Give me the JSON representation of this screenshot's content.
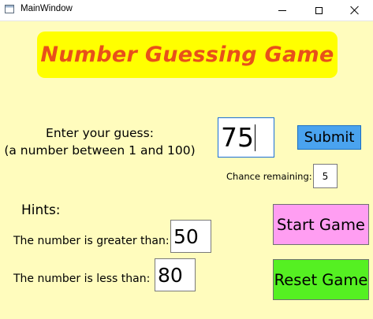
{
  "window": {
    "title": "MainWindow"
  },
  "banner": {
    "title": "Number Guessing Game"
  },
  "guess": {
    "prompt_line1": "Enter your guess:",
    "prompt_line2": "(a number between 1 and 100)",
    "value": "75",
    "submit_label": "Submit"
  },
  "chances": {
    "label": "Chance remaining:",
    "value": "5"
  },
  "hints": {
    "title": "Hints:",
    "greater_label": "The number is greater than:",
    "greater_value": "50",
    "less_label": "The number is less than:",
    "less_value": "80"
  },
  "controls": {
    "start_label": "Start Game",
    "reset_label": "Reset Game"
  },
  "colors": {
    "background": "#fffcbd",
    "banner": "#ffff00",
    "banner_text": "#e8501a",
    "submit": "#4aa3ef",
    "start": "#ff9ef2",
    "reset": "#55f022"
  }
}
